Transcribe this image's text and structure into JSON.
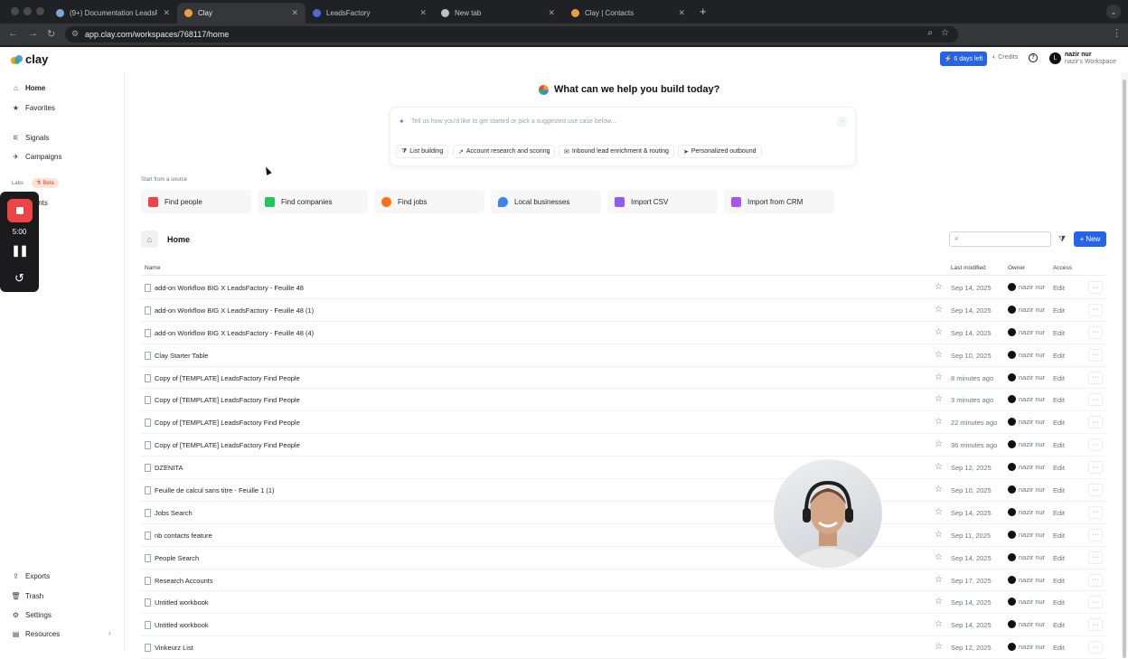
{
  "browser": {
    "tabs": [
      {
        "label": "(9+) Documentation LeadsFa",
        "favicon_color": "#7aa7d9",
        "active": false
      },
      {
        "label": "Clay",
        "favicon_color": "#e8a13a",
        "active": true
      },
      {
        "label": "LeadsFactory",
        "favicon_color": "#4f6bd8",
        "active": false
      },
      {
        "label": "New tab",
        "favicon_color": "#bdc1c6",
        "active": false
      },
      {
        "label": "Clay | Contacts",
        "favicon_color": "#e8a13a",
        "active": false
      }
    ],
    "url": "app.clay.com/workspaces/768117/home"
  },
  "header": {
    "logo_text": "clay",
    "trial_label": "6 days left",
    "credits_label": "Credits",
    "user_initial": "L",
    "user_name": "nazir nur",
    "workspace_name": "nazir's Workspace"
  },
  "sidebar": {
    "items": [
      {
        "label": "Home",
        "icon": "home-icon"
      },
      {
        "label": "Favorites",
        "icon": "star-icon"
      },
      {
        "label": "Signals",
        "icon": "signal-icon"
      },
      {
        "label": "Campaigns",
        "icon": "campaign-icon"
      },
      {
        "label": "Agents",
        "icon": "agent-icon"
      },
      {
        "label": "Exports",
        "icon": "export-icon"
      },
      {
        "label": "Trash",
        "icon": "trash-icon"
      },
      {
        "label": "Settings",
        "icon": "gear-icon"
      },
      {
        "label": "Resources",
        "icon": "book-icon"
      }
    ],
    "labs_label": "Labs",
    "beta_label": "Beta"
  },
  "recorder": {
    "time": "5:00"
  },
  "main": {
    "headline": "What can we help you build today?",
    "prompt_placeholder": "Tell us how you'd like to get started or pick a suggested use case below...",
    "chips": [
      {
        "label": "List building",
        "icon": "filter-icon"
      },
      {
        "label": "Account research and scoring",
        "icon": "trend-icon"
      },
      {
        "label": "Inbound lead enrichment & routing",
        "icon": "mail-icon"
      },
      {
        "label": "Personalized outbound",
        "icon": "send-icon"
      }
    ],
    "source_label": "Start from a source",
    "sources": [
      {
        "label": "Find people",
        "color": "#ef4444"
      },
      {
        "label": "Find companies",
        "color": "#22c55e"
      },
      {
        "label": "Find jobs",
        "color": "#f97316"
      },
      {
        "label": "Local businesses",
        "color": "#3b82f6"
      },
      {
        "label": "Import CSV",
        "color": "#8b5cf6"
      },
      {
        "label": "Import from CRM",
        "color": "#a855f7"
      }
    ],
    "section_title": "Home",
    "new_label": "New",
    "columns": {
      "name": "Name",
      "last_modified": "Last modified",
      "owner": "Owner",
      "access": "Access"
    },
    "rows": [
      {
        "name": "add-on Workflow BIG X LeadsFactory - Feuille 48",
        "modified": "Sep 14, 2025",
        "owner": "nazir nur",
        "access": "Edit"
      },
      {
        "name": "add-on Workflow BIG X LeadsFactory - Feuille 48 (1)",
        "modified": "Sep 14, 2025",
        "owner": "nazir nur",
        "access": "Edit"
      },
      {
        "name": "add-on Workflow BIG X LeadsFactory - Feuille 48 (4)",
        "modified": "Sep 14, 2025",
        "owner": "nazir nur",
        "access": "Edit"
      },
      {
        "name": "Clay Starter Table",
        "modified": "Sep 10, 2025",
        "owner": "nazir nur",
        "access": "Edit"
      },
      {
        "name": "Copy of [TEMPLATE] LeadsFactory Find People",
        "modified": "8 minutes ago",
        "owner": "nazir nur",
        "access": "Edit"
      },
      {
        "name": "Copy of [TEMPLATE] LeadsFactory Find People",
        "modified": "3 minutes ago",
        "owner": "nazir nur",
        "access": "Edit"
      },
      {
        "name": "Copy of [TEMPLATE] LeadsFactory Find People",
        "modified": "22 minutes ago",
        "owner": "nazir nur",
        "access": "Edit"
      },
      {
        "name": "Copy of [TEMPLATE] LeadsFactory Find People",
        "modified": "36 minutes ago",
        "owner": "nazir nur",
        "access": "Edit"
      },
      {
        "name": "DZENITA",
        "modified": "Sep 12, 2025",
        "owner": "nazir nur",
        "access": "Edit"
      },
      {
        "name": "Feuille de calcul sans titre - Feuille 1 (1)",
        "modified": "Sep 10, 2025",
        "owner": "nazir nur",
        "access": "Edit"
      },
      {
        "name": "Jobs Search",
        "modified": "Sep 14, 2025",
        "owner": "nazir nur",
        "access": "Edit"
      },
      {
        "name": "nb contacts feature",
        "modified": "Sep 11, 2025",
        "owner": "nazir nur",
        "access": "Edit"
      },
      {
        "name": "People Search",
        "modified": "Sep 14, 2025",
        "owner": "nazir nur",
        "access": "Edit"
      },
      {
        "name": "Research Accounts",
        "modified": "Sep 17, 2025",
        "owner": "nazir nur",
        "access": "Edit"
      },
      {
        "name": "Untitled workbook",
        "modified": "Sep 14, 2025",
        "owner": "nazir nur",
        "access": "Edit"
      },
      {
        "name": "Untitled workbook",
        "modified": "Sep 14, 2025",
        "owner": "nazir nur",
        "access": "Edit"
      },
      {
        "name": "Vinkeurz List",
        "modified": "Sep 12, 2025",
        "owner": "nazir nur",
        "access": "Edit"
      }
    ]
  }
}
